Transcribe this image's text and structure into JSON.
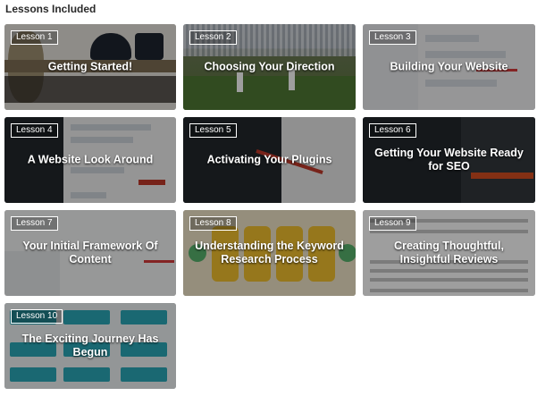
{
  "section": {
    "title": "Lessons Included"
  },
  "lessons": [
    {
      "badge": "Lesson 1",
      "title": "Getting Started!"
    },
    {
      "badge": "Lesson 2",
      "title": "Choosing Your Direction"
    },
    {
      "badge": "Lesson 3",
      "title": "Building Your Website"
    },
    {
      "badge": "Lesson 4",
      "title": "A Website Look Around"
    },
    {
      "badge": "Lesson 5",
      "title": "Activating Your Plugins"
    },
    {
      "badge": "Lesson 6",
      "title": "Getting Your Website Ready for SEO"
    },
    {
      "badge": "Lesson 7",
      "title": "Your Initial Framework Of Content"
    },
    {
      "badge": "Lesson 8",
      "title": "Understanding the Keyword Research Process"
    },
    {
      "badge": "Lesson 9",
      "title": "Creating Thoughtful, Insightful Reviews"
    },
    {
      "badge": "Lesson 10",
      "title": "The Exciting Journey Has Begun"
    }
  ]
}
